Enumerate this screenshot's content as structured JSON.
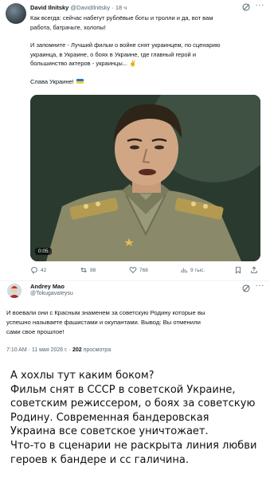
{
  "post1": {
    "author_name": "David Ilnitsky",
    "author_handle": "@DavidIlnitsky",
    "separator": "·",
    "time": "18 ч",
    "paragraphs": [
      "Как всегда: сейчас набегут рублёвые боты и тролли и да, вот вам\nработа, батрачьте, холопы!",
      "И запомните - Лучший фильм о войне снят украинцем, по сценарию\nукраинца, в Украине, о боях в Украине, где главный герой и\nбольшинство актеров - украинцы... ✌",
      "Слава Украине!"
    ],
    "video_duration": "0:05",
    "actions": {
      "replies": "42",
      "reposts": "98",
      "likes": "768",
      "views": "9 тыс."
    },
    "icons": [
      "grok-icon",
      "more-icon",
      "reply-icon",
      "repost-icon",
      "like-icon",
      "views-icon",
      "bookmark-icon",
      "share-icon"
    ]
  },
  "post2": {
    "author_name": "Andrey Mao",
    "author_handle": "@TokugavaIeysu",
    "text_lines": [
      "И воевали они с Красным знаменем за советскую Родину которые вы",
      "успешно называете фашистами и окупантами. Вывод: Вы отменили",
      "сами свое прошлое!"
    ],
    "timestamp": "7:10 AM · 11 мая 2026 г. ·",
    "views_count": "202",
    "views_label": "просмотра"
  },
  "comment": {
    "lines": [
      "А хохлы тут каким боком?",
      "Фильм снят в СССР в советской Украине,",
      "советским режиссером, о боях за советскую",
      "Родину. Современная бандеровская",
      "Украина все советское уничтожает.",
      "Что-то в сценарии не раскрыта линия любви",
      "героев к бандере и  сс галичина."
    ]
  },
  "colors": {
    "text": "#0f1419",
    "muted": "#536471",
    "divider": "#eff3f4"
  }
}
